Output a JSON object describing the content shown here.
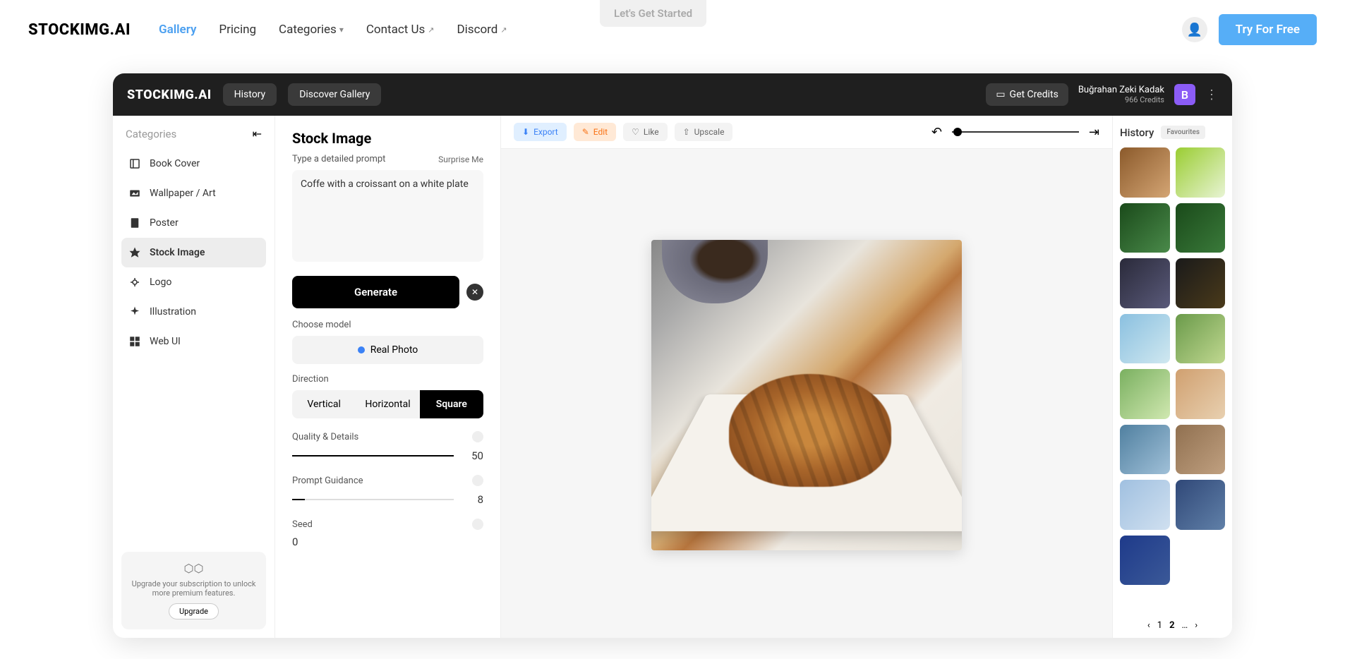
{
  "site": {
    "logo": "STOCKIMG.AI",
    "nav": {
      "gallery": "Gallery",
      "pricing": "Pricing",
      "categories": "Categories",
      "contact": "Contact Us",
      "discord": "Discord"
    },
    "tryFree": "Try For Free",
    "letsGetStarted": "Let's Get Started"
  },
  "app": {
    "logo": "STOCKIMG.AI",
    "tabs": {
      "history": "History",
      "discover": "Discover Gallery"
    },
    "getCredits": "Get Credits",
    "user": {
      "name": "Buğrahan Zeki Kadak",
      "credits": "966 Credits",
      "initial": "B"
    }
  },
  "sidebar": {
    "title": "Categories",
    "items": [
      {
        "label": "Book Cover"
      },
      {
        "label": "Wallpaper / Art"
      },
      {
        "label": "Poster"
      },
      {
        "label": "Stock Image"
      },
      {
        "label": "Logo"
      },
      {
        "label": "Illustration"
      },
      {
        "label": "Web UI"
      }
    ],
    "upgrade": {
      "text": "Upgrade your subscription to unlock more premium features.",
      "button": "Upgrade"
    }
  },
  "panel": {
    "title": "Stock Image",
    "promptLabel": "Type a detailed prompt",
    "surprise": "Surprise Me",
    "promptValue": "Coffe with a croissant on a white plate",
    "generate": "Generate",
    "chooseModel": "Choose model",
    "model": "Real Photo",
    "directionLabel": "Direction",
    "directions": {
      "vertical": "Vertical",
      "horizontal": "Horizontal",
      "square": "Square"
    },
    "quality": {
      "label": "Quality & Details",
      "value": "50"
    },
    "guidance": {
      "label": "Prompt Guidance",
      "value": "8"
    },
    "seed": {
      "label": "Seed",
      "value": "0"
    }
  },
  "toolbar": {
    "export": "Export",
    "edit": "Edit",
    "like": "Like",
    "upscale": "Upscale"
  },
  "history": {
    "historyTab": "History",
    "favTab": "Favourites",
    "pages": {
      "p1": "1",
      "p2": "2",
      "ellipsis": "…"
    }
  }
}
